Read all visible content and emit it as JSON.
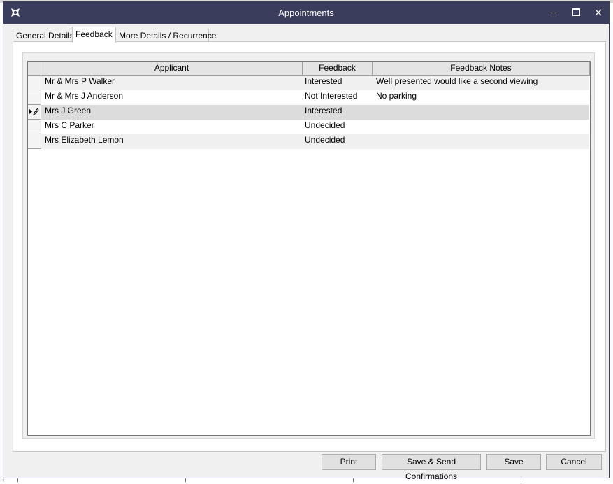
{
  "window": {
    "title": "Appointments",
    "icon": "app-logo-icon",
    "controls": {
      "minimize": "minimize-icon",
      "maximize": "maximize-icon",
      "close": "close-icon"
    },
    "titlebar_color": "#3b3d5c"
  },
  "tabs": [
    {
      "label": "General Details"
    },
    {
      "label": "Feedback",
      "active": true
    },
    {
      "label": "More Details / Recurrence"
    }
  ],
  "grid": {
    "columns": [
      "Applicant",
      "Feedback",
      "Feedback Notes"
    ],
    "rows": [
      {
        "applicant": "Mr & Mrs P Walker",
        "feedback": "Interested",
        "notes": "Well presented would like a second viewing"
      },
      {
        "applicant": "Mr & Mrs J Anderson",
        "feedback": "Not Interested",
        "notes": "No parking"
      },
      {
        "applicant": "Mrs J Green",
        "feedback": "Interested",
        "notes": "",
        "selected": true,
        "indicator": "edit-pencil-icon"
      },
      {
        "applicant": "Mrs C Parker",
        "feedback": "Undecided",
        "notes": ""
      },
      {
        "applicant": "Mrs Elizabeth Lemon",
        "feedback": "Undecided",
        "notes": ""
      }
    ]
  },
  "buttons": {
    "print": "Print",
    "save_send": "Save & Send Confirmations",
    "save": "Save",
    "cancel": "Cancel"
  }
}
